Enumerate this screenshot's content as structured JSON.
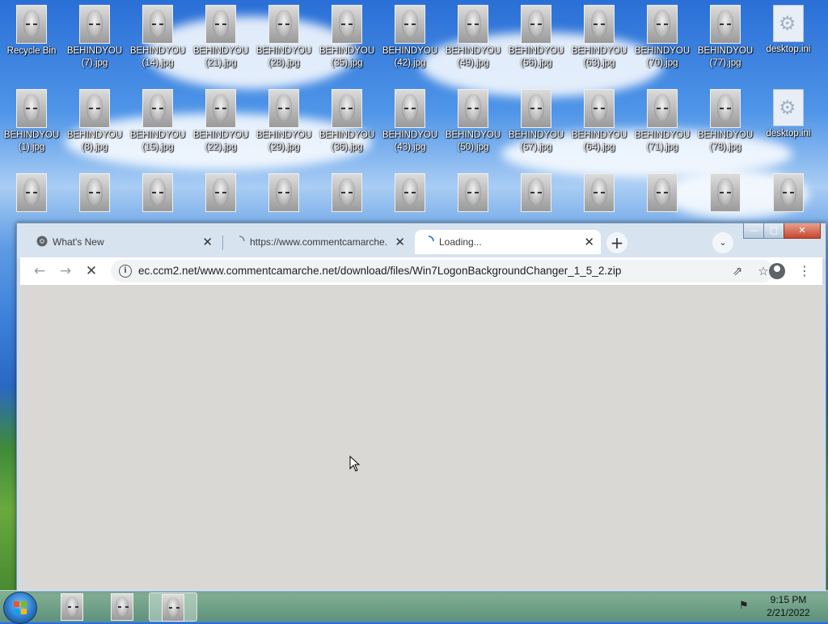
{
  "desktop": {
    "icons_row1": [
      {
        "label": "Recycle Bin",
        "kind": "photo"
      },
      {
        "label": "BEHINDYOU (7).jpg",
        "kind": "photo"
      },
      {
        "label": "BEHINDYOU (14).jpg",
        "kind": "photo"
      },
      {
        "label": "BEHINDYOU (21).jpg",
        "kind": "photo"
      },
      {
        "label": "BEHINDYOU (28).jpg",
        "kind": "photo"
      },
      {
        "label": "BEHINDYOU (35).jpg",
        "kind": "photo"
      },
      {
        "label": "BEHINDYOU (42).jpg",
        "kind": "photo"
      },
      {
        "label": "BEHINDYOU (49).jpg",
        "kind": "photo"
      },
      {
        "label": "BEHINDYOU (56).jpg",
        "kind": "photo"
      },
      {
        "label": "BEHINDYOU (63).jpg",
        "kind": "photo"
      },
      {
        "label": "BEHINDYOU (70).jpg",
        "kind": "photo"
      },
      {
        "label": "BEHINDYOU (77).jpg",
        "kind": "photo"
      },
      {
        "label": "desktop.ini",
        "kind": "settings-file"
      }
    ],
    "icons_row2": [
      {
        "label": "BEHINDYOU (1).jpg",
        "kind": "photo"
      },
      {
        "label": "BEHINDYOU (8).jpg",
        "kind": "photo"
      },
      {
        "label": "BEHINDYOU (15).jpg",
        "kind": "photo"
      },
      {
        "label": "BEHINDYOU (22).jpg",
        "kind": "photo"
      },
      {
        "label": "BEHINDYOU (29).jpg",
        "kind": "photo"
      },
      {
        "label": "BEHINDYOU (36).jpg",
        "kind": "photo"
      },
      {
        "label": "BEHINDYOU (43).jpg",
        "kind": "photo"
      },
      {
        "label": "BEHINDYOU (50).jpg",
        "kind": "photo"
      },
      {
        "label": "BEHINDYOU (57).jpg",
        "kind": "photo"
      },
      {
        "label": "BEHINDYOU (64).jpg",
        "kind": "photo"
      },
      {
        "label": "BEHINDYOU (71).jpg",
        "kind": "photo"
      },
      {
        "label": "BEHINDYOU (78).jpg",
        "kind": "photo"
      },
      {
        "label": "desktop.ini",
        "kind": "settings-file"
      }
    ],
    "icons_row3_count": 13
  },
  "browser": {
    "tabs": [
      {
        "title": "What's New",
        "icon": "chrome-icon",
        "active": false
      },
      {
        "title": "https://www.commentcamarche.",
        "icon": "loading-spinner-icon",
        "active": false
      },
      {
        "title": "Loading...",
        "icon": "loading-spinner-icon",
        "active": true
      }
    ],
    "tab_close_glyph": "✕",
    "new_tab_glyph": "+",
    "tab_search_glyph": "⌄",
    "url": "ec.ccm2.net/www.commentcamarche.net/download/files/Win7LogonBackgroundChanger_1_5_2.zip",
    "window_buttons": {
      "minimize": "—",
      "maximize": "□",
      "close": "✕"
    },
    "nav": {
      "back": "←",
      "forward": "→",
      "stop": "✕"
    },
    "omni_info": "i",
    "share_glyph": "⇗",
    "star_glyph": "☆",
    "menu_glyph": "⋮"
  },
  "taskbar": {
    "items": [
      {
        "name": "photo-viewer-1",
        "active": false
      },
      {
        "name": "photo-viewer-2",
        "active": false
      },
      {
        "name": "photo-viewer-3",
        "active": true
      }
    ],
    "tray_glyph": "⚑",
    "time": "9:15 PM",
    "date": "2/21/2022"
  },
  "colors": {
    "tab_active": "#ffffff",
    "tabstrip": "#d7e3ef",
    "content_bg": "#dad8d5",
    "close_button": "#c7472e"
  }
}
